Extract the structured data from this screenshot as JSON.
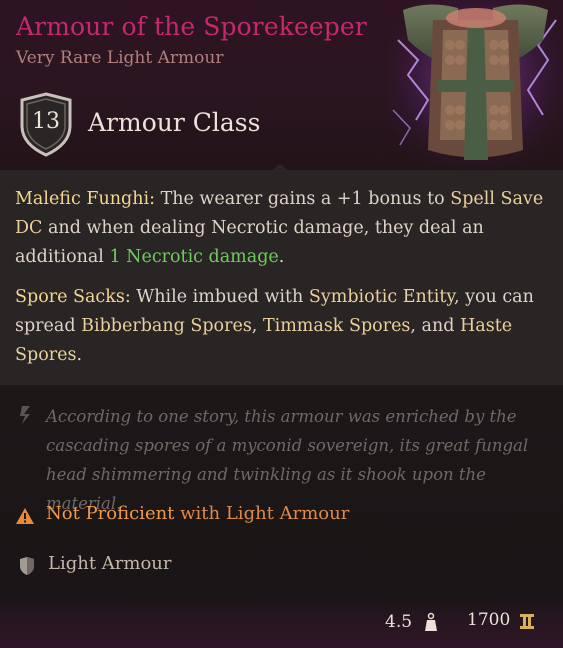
{
  "item": {
    "name": "Armour of the Sporekeeper",
    "rarity_type": "Very Rare Light Armour",
    "armour_class": {
      "value": "13",
      "label": "Armour Class"
    }
  },
  "passives": [
    {
      "name": "Malefic Funghi:",
      "t1": " The wearer gains a +1 bonus to ",
      "k1": "Spell Save DC",
      "t2": " and when dealing Necrotic damage, they deal an additional ",
      "k2": "1 Necrotic damage",
      "t3": "."
    },
    {
      "name": "Spore Sacks:",
      "t1": " While imbued with ",
      "k1": "Symbiotic Entity",
      "t2": ", you can spread ",
      "k2": "Bibberbang Spores",
      "t3": ", ",
      "k3": "Timmask Spores",
      "t4": ", and ",
      "k4": "Haste Spores",
      "t5": "."
    }
  ],
  "flavor_text": "According to one story, this armour was enriched by the cascading spores of a myconid sovereign, its great fungal head shimmering and twinkling as it shook upon the material.",
  "proficiency_warning": {
    "part1": "Not Proficient",
    "part2": " with Light Armour",
    "icon": "warning-triangle-icon",
    "color": "#e88a3a"
  },
  "armour_type": {
    "label": "Light Armour",
    "icon": "light-armour-shield-icon"
  },
  "footer": {
    "weight": "4.5",
    "weight_icon": "weight-icon",
    "price": "1700",
    "price_icon": "gold-coin-icon"
  },
  "colors": {
    "title": "#c6286c",
    "subtitle": "#b0807e",
    "keyword": "#e8d19a",
    "keyword_heading": "#f3d78f",
    "necrotic_damage": "#6fcc5c",
    "flavor": "#6f6866"
  }
}
